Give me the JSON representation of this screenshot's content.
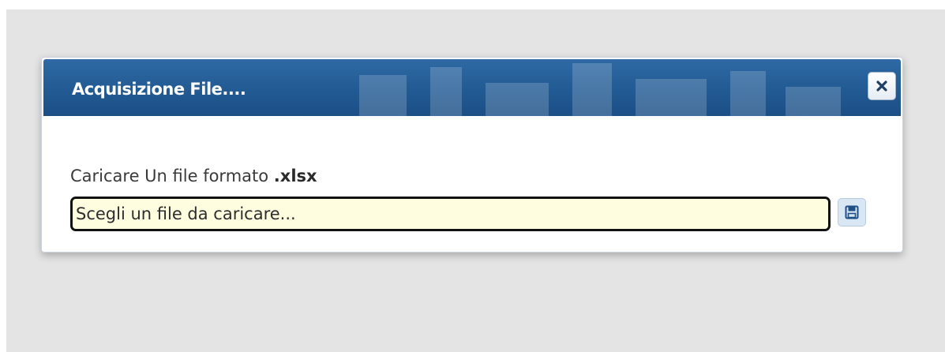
{
  "dialog": {
    "title": "Acquisizione File....",
    "close_icon": "close-icon",
    "instruction_prefix": "Caricare Un file formato ",
    "instruction_extension": ".xlsx",
    "file_input": {
      "placeholder": "Scegli un file da caricare...",
      "value": ""
    },
    "save_icon": "floppy-disk-icon"
  },
  "colors": {
    "titlebar": "#225a93",
    "input_background": "#fefde0",
    "page_background": "#e4e4e4"
  }
}
